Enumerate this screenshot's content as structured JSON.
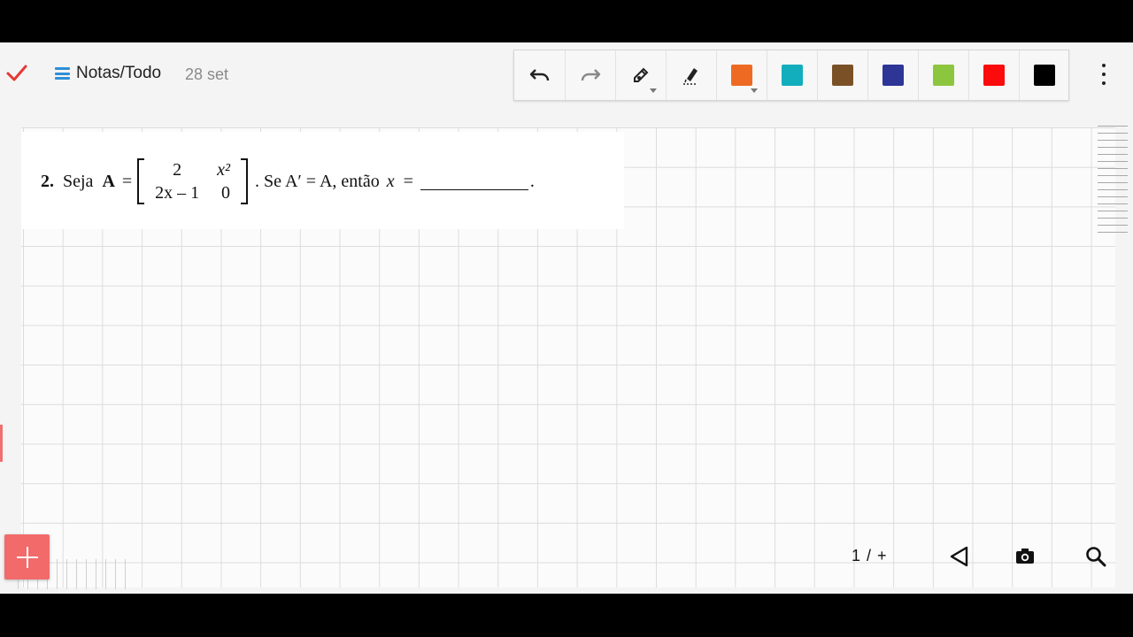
{
  "header": {
    "done_icon": "check-icon",
    "notebook_title": "Notas/Todo",
    "date": "28 set"
  },
  "toolbar": {
    "tools": [
      "undo-icon",
      "redo-icon",
      "pen-tool-icon",
      "eraser-icon"
    ],
    "colors": [
      "#ee6a22",
      "#12aebd",
      "#7a5127",
      "#2d3597",
      "#8cc63f",
      "#fb0b0b",
      "#000000"
    ]
  },
  "problem": {
    "number": "2.",
    "intro": "Seja",
    "matrix_name": "A",
    "equals": "=",
    "matrix": [
      [
        "2",
        "x²"
      ],
      [
        "2x – 1",
        "0"
      ]
    ],
    "condition": ". Se A′ = A, então",
    "variable": "x",
    "equals2": "=",
    "end": "."
  },
  "footer": {
    "page_indicator": "1 / +"
  },
  "colors": {
    "accent_red": "#e53935",
    "menu_blue": "#2f8fd6",
    "add_button": "#f26a6a"
  }
}
